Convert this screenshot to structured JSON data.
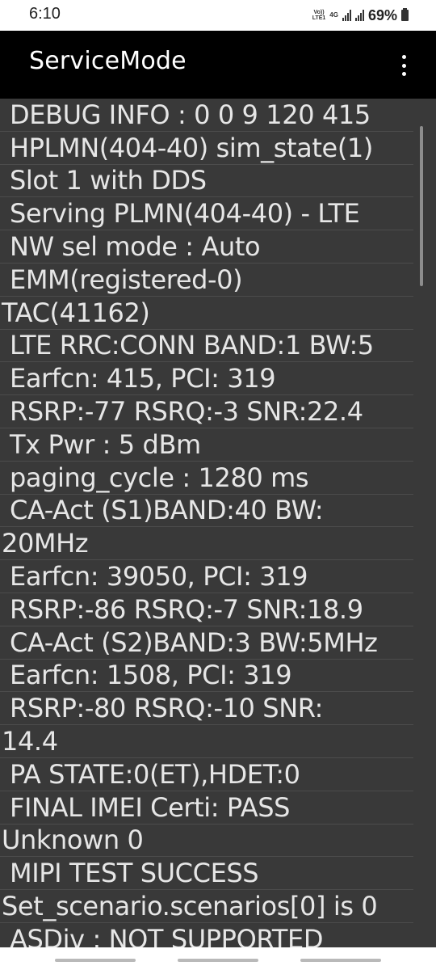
{
  "status_bar": {
    "time": "6:10",
    "volte_label": "Vo)) LTE1",
    "network_label": "4G",
    "battery_percent": "69%",
    "icons": [
      "volte-icon",
      "4g-icon",
      "signal-icon",
      "signal-icon",
      "battery-icon"
    ]
  },
  "app_bar": {
    "title": "ServiceMode",
    "menu_icon": "more-vert-icon"
  },
  "lines": [
    "DEBUG INFO : 0 0 9 120 415",
    "HPLMN(404-40) sim_state(1)",
    "Slot 1 with DDS",
    "Serving PLMN(404-40) - LTE",
    "NW sel mode : Auto",
    "EMM(registered-0)",
    "TAC(41162)",
    "LTE RRC:CONN BAND:1 BW:5",
    "Earfcn: 415, PCI: 319",
    "RSRP:-77 RSRQ:-3 SNR:22.4",
    "Tx Pwr : 5 dBm",
    "paging_cycle : 1280 ms",
    "CA-Act (S1)BAND:40 BW:",
    "20MHz",
    "Earfcn: 39050, PCI: 319",
    "RSRP:-86 RSRQ:-7 SNR:18.9",
    "CA-Act (S2)BAND:3 BW:5MHz",
    "Earfcn: 1508, PCI: 319",
    "RSRP:-80 RSRQ:-10 SNR:",
    "14.4",
    "PA STATE:0(ET),HDET:0",
    "FINAL IMEI Certi: PASS",
    "Unknown 0",
    "MIPI TEST SUCCESS",
    "Set_scenario.scenarios[0] is 0",
    "ASDiv : NOT SUPPORTED"
  ],
  "colors": {
    "status_bar_bg": "#ffffff",
    "app_bar_bg": "#000000",
    "content_bg": "#393939",
    "text": "#e6e6e6",
    "divider": "#4c4c4c",
    "nav_bar_bg": "#ffffff"
  }
}
